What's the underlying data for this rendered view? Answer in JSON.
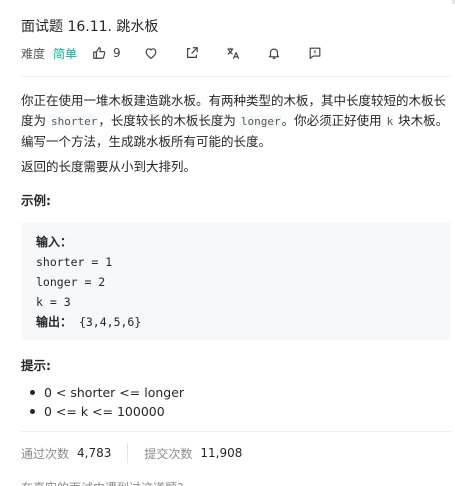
{
  "problem": {
    "title": "面试题 16.11. 跳水板",
    "difficulty_label": "难度",
    "difficulty": "简单",
    "likes": "9"
  },
  "description": {
    "p1_a": "你正在使用一堆木板建造跳水板。有两种类型的木板，其中长度较短的木板长度为 ",
    "p1_code1": "shorter",
    "p1_b": "，长度较长的木板长度为 ",
    "p1_code2": "longer",
    "p1_c": "。你必须正好使用 ",
    "p1_code3": "k",
    "p1_d": " 块木板。编写一个方法，生成跳水板所有可能的长度。",
    "p2": "返回的长度需要从小到大排列。"
  },
  "example": {
    "heading": "示例:",
    "input_label": "输入：",
    "lines": [
      "shorter = 1",
      "longer = 2",
      "k = 3"
    ],
    "output_label": "输出：",
    "output_value": "{3,4,5,6}"
  },
  "tips": {
    "heading": "提示:",
    "items": [
      "0 < shorter <= longer",
      "0 <= k <= 100000"
    ]
  },
  "stats": {
    "accepted_label": "通过次数",
    "accepted_value": "4,783",
    "submitted_label": "提交次数",
    "submitted_value": "11,908"
  },
  "cutoff_text": "在真实的面试中遇到过这道题?"
}
